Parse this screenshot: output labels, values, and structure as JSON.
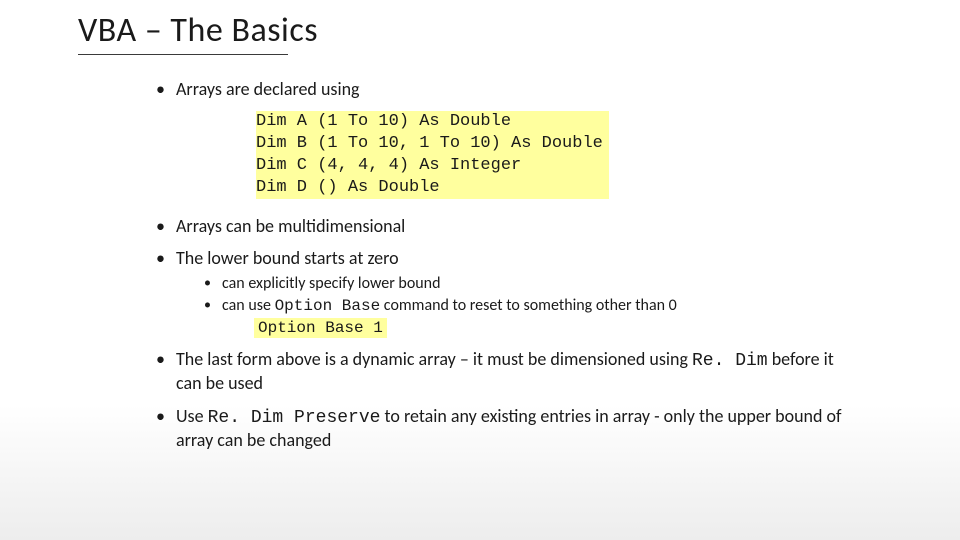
{
  "title": "VBA – The Basics",
  "bullets": {
    "b1": "Arrays are declared using",
    "code1": "Dim A (1 To 10) As Double\nDim B (1 To 10, 1 To 10) As Double\nDim C (4, 4, 4) As Integer\nDim D () As Double",
    "b2": "Arrays can be multidimensional",
    "b3": "The lower bound starts at zero",
    "b3_sub1": "can explicitly specify lower bound",
    "b3_sub2_pre": "can use ",
    "b3_sub2_code": "Option Base",
    "b3_sub2_post": " command to reset to something other than 0",
    "b3_sub2_example": "Option Base 1",
    "b4_pre": "The last form above is a dynamic array – it must be dimensioned using ",
    "b4_code": "Re. Dim",
    "b4_post": " before it can be used",
    "b5_pre": "Use ",
    "b5_code": "Re. Dim Preserve",
    "b5_post": " to retain any existing entries in array - only the upper bound of array can be changed"
  }
}
